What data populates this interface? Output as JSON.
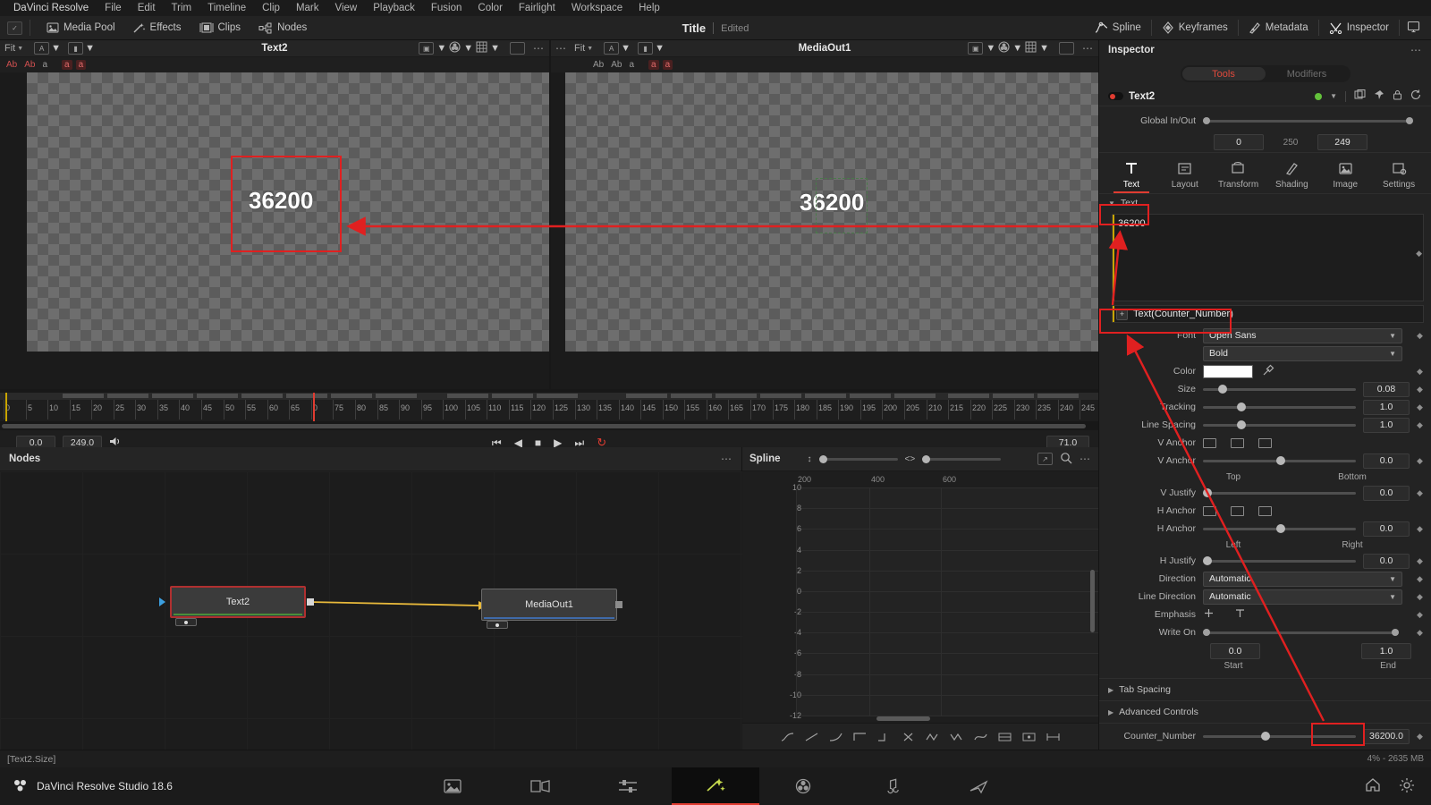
{
  "menubar": {
    "items": [
      "DaVinci Resolve",
      "File",
      "Edit",
      "Trim",
      "Timeline",
      "Clip",
      "Mark",
      "View",
      "Playback",
      "Fusion",
      "Color",
      "Fairlight",
      "Workspace",
      "Help"
    ]
  },
  "toolbar": {
    "left_items": [
      {
        "label": "Media Pool",
        "icon": "media-pool-icon"
      },
      {
        "label": "Effects",
        "icon": "effects-icon"
      },
      {
        "label": "Clips",
        "icon": "clips-icon"
      },
      {
        "label": "Nodes",
        "icon": "nodes-icon"
      }
    ],
    "title": "Title",
    "edited": "Edited",
    "right_items": [
      {
        "label": "Spline",
        "icon": "spline-icon"
      },
      {
        "label": "Keyframes",
        "icon": "keyframes-icon"
      },
      {
        "label": "Metadata",
        "icon": "metadata-icon"
      },
      {
        "label": "Inspector",
        "icon": "inspector-icon"
      }
    ]
  },
  "viewer_left": {
    "fit_label": "Fit",
    "title": "Text2",
    "text_overlay": "36200",
    "sub_buttons": [
      "Ab",
      "Ab",
      "a",
      "a",
      "a"
    ]
  },
  "viewer_right": {
    "fit_label": "Fit",
    "title": "MediaOut1",
    "text_overlay": "36200",
    "sub_buttons": [
      "Ab",
      "Ab",
      "a",
      "a",
      "a"
    ]
  },
  "timeline": {
    "tick_labels": [
      "0",
      "5",
      "10",
      "15",
      "20",
      "25",
      "30",
      "35",
      "40",
      "45",
      "50",
      "55",
      "60",
      "65",
      "0",
      "75",
      "80",
      "85",
      "90",
      "95",
      "100",
      "105",
      "110",
      "115",
      "120",
      "125",
      "130",
      "135",
      "140",
      "145",
      "150",
      "155",
      "160",
      "165",
      "170",
      "175",
      "180",
      "185",
      "190",
      "195",
      "200",
      "205",
      "210",
      "215",
      "220",
      "225",
      "230",
      "235",
      "240",
      "245"
    ],
    "start": "0.0",
    "end": "249.0",
    "current": "71.0"
  },
  "nodes_panel": {
    "title": "Nodes",
    "node_text2": "Text2",
    "node_mediaout": "MediaOut1"
  },
  "spline_panel": {
    "title": "Spline",
    "y_labels": [
      "10",
      "8",
      "6",
      "4",
      "2",
      "0",
      "-2",
      "-4",
      "-6",
      "-8",
      "-10",
      "-12"
    ],
    "x_labels": [
      "200",
      "400",
      "600"
    ]
  },
  "inspector": {
    "title": "Inspector",
    "tabs": [
      {
        "label": "Tools",
        "active": true
      },
      {
        "label": "Modifiers",
        "active": false
      }
    ],
    "node_name": "Text2",
    "global_inout": {
      "label": "Global In/Out",
      "in_value": "0",
      "mid_value": "250",
      "out_value": "249"
    },
    "prop_tabs": [
      {
        "label": "Text",
        "icon": "text-tool-icon",
        "active": true
      },
      {
        "label": "Layout",
        "icon": "layout-tool-icon",
        "active": false
      },
      {
        "label": "Transform",
        "icon": "transform-tool-icon",
        "active": false
      },
      {
        "label": "Shading",
        "icon": "shading-tool-icon",
        "active": false
      },
      {
        "label": "Image",
        "icon": "image-tool-icon",
        "active": false
      },
      {
        "label": "Settings",
        "icon": "settings-tool-icon",
        "active": false
      }
    ],
    "section_text": "Text",
    "styled_text_value": "36200",
    "modifier_label": "Text(Counter_Number)",
    "fields": {
      "font_label": "Font",
      "font_value": "Open Sans",
      "font_style_value": "Bold",
      "color_label": "Color",
      "size_label": "Size",
      "size_value": "0.08",
      "tracking_label": "Tracking",
      "tracking_value": "1.0",
      "line_spacing_label": "Line Spacing",
      "line_spacing_value": "1.0",
      "v_anchor_icons_label": "V Anchor",
      "v_anchor_label": "V Anchor",
      "v_anchor_value": "0.0",
      "v_anchor_min": "Top",
      "v_anchor_max": "Bottom",
      "v_justify_label": "V Justify",
      "v_justify_value": "0.0",
      "h_anchor_icons_label": "H Anchor",
      "h_anchor_label": "H Anchor",
      "h_anchor_value": "0.0",
      "h_anchor_min": "Left",
      "h_anchor_max": "Right",
      "h_justify_label": "H Justify",
      "h_justify_value": "0.0",
      "direction_label": "Direction",
      "direction_value": "Automatic",
      "line_direction_label": "Line Direction",
      "line_direction_value": "Automatic",
      "emphasis_label": "Emphasis",
      "write_on_label": "Write On",
      "write_on_start": "0.0",
      "write_on_end": "1.0",
      "start_label": "Start",
      "end_label": "End"
    },
    "collapsed_sections": [
      "Tab Spacing",
      "Advanced Controls"
    ],
    "counter": {
      "label": "Counter_Number",
      "value": "36200.0"
    }
  },
  "status": {
    "left": "[Text2.Size]",
    "right": "4% - 2635 MB"
  },
  "bottombar": {
    "brand": "DaVinci Resolve Studio 18.6",
    "pages": [
      "media-page-icon",
      "cut-page-icon",
      "edit-page-icon",
      "fusion-page-icon",
      "color-page-icon",
      "fairlight-page-icon",
      "deliver-page-icon"
    ],
    "right_icons": [
      "home-icon",
      "settings-icon"
    ]
  },
  "colors": {
    "accent_red": "#e03c31",
    "annotation_red": "#e02020",
    "highlight_yellow": "#c8a400",
    "node_link": "#e8b93b"
  }
}
